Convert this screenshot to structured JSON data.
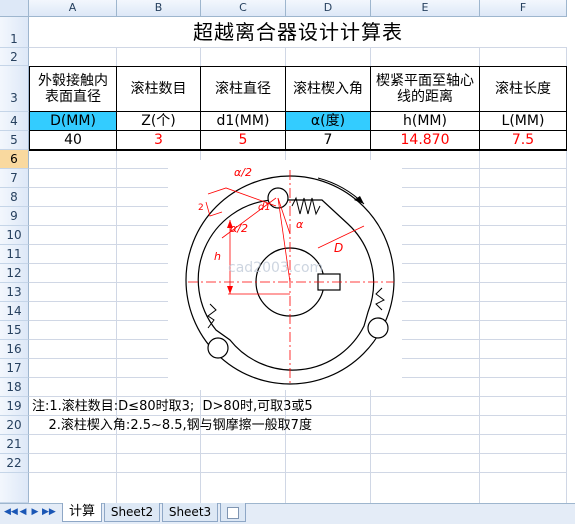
{
  "columns": [
    "A",
    "B",
    "C",
    "D",
    "E",
    "F"
  ],
  "rows": [
    "1",
    "2",
    "3",
    "4",
    "5",
    "6",
    "7",
    "8",
    "9",
    "10",
    "11",
    "12",
    "13",
    "14",
    "15",
    "16",
    "17",
    "18",
    "19",
    "20",
    "21",
    "22"
  ],
  "sheet": {
    "title": "超越离合器设计计算表",
    "headers": [
      "外毂接触内表面直径",
      "滚柱数目",
      "滚柱直径",
      "滚柱楔入角",
      "楔紧平面至轴心线的距离",
      "滚柱长度"
    ],
    "units": [
      "D(MM)",
      "Z(个)",
      "d1(MM)",
      "α(度)",
      "h(MM)",
      "L(MM)"
    ],
    "values": [
      "40",
      "3",
      "5",
      "7",
      "14.870",
      "7.5"
    ],
    "notes": [
      "注:1.滚柱数目:D≤80时取3;  D>80时,可取3或5",
      "    2.滚柱楔入角:2.5~8.5,钢与钢摩擦一般取7度"
    ]
  },
  "drawing": {
    "labels": {
      "alpha_half_top": "α/2",
      "alpha_half": "α/2",
      "alpha": "α",
      "d1": "d1",
      "D": "D",
      "h": "h",
      "small": "2"
    },
    "watermark": "cad2003.com"
  },
  "tabs": [
    "计算",
    "Sheet2",
    "Sheet3"
  ],
  "nav_buttons": [
    "◀◀",
    "◀",
    "▶",
    "▶▶"
  ],
  "colors": {
    "header_bg": "#dde8f7",
    "selected_row": "#f9d99f",
    "cyan_fill": "#33ccff",
    "red_text": "#ff0000",
    "drawing_red": "#ff0000"
  }
}
